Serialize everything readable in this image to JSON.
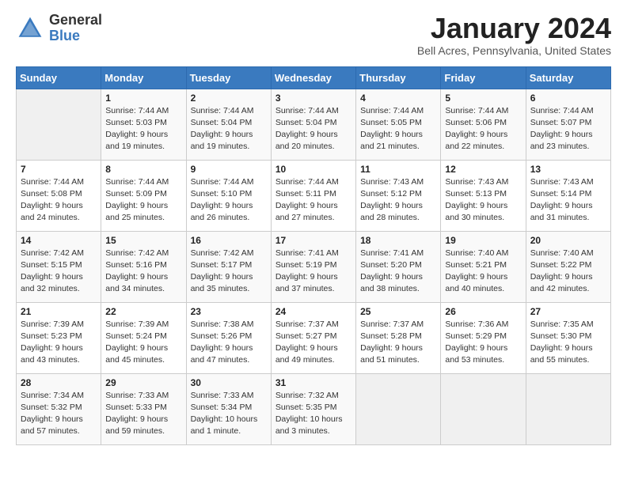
{
  "header": {
    "logo_general": "General",
    "logo_blue": "Blue",
    "month_year": "January 2024",
    "location": "Bell Acres, Pennsylvania, United States"
  },
  "weekdays": [
    "Sunday",
    "Monday",
    "Tuesday",
    "Wednesday",
    "Thursday",
    "Friday",
    "Saturday"
  ],
  "weeks": [
    [
      {
        "day": "",
        "empty": true
      },
      {
        "day": "1",
        "sunrise": "Sunrise: 7:44 AM",
        "sunset": "Sunset: 5:03 PM",
        "daylight": "Daylight: 9 hours and 19 minutes."
      },
      {
        "day": "2",
        "sunrise": "Sunrise: 7:44 AM",
        "sunset": "Sunset: 5:04 PM",
        "daylight": "Daylight: 9 hours and 19 minutes."
      },
      {
        "day": "3",
        "sunrise": "Sunrise: 7:44 AM",
        "sunset": "Sunset: 5:04 PM",
        "daylight": "Daylight: 9 hours and 20 minutes."
      },
      {
        "day": "4",
        "sunrise": "Sunrise: 7:44 AM",
        "sunset": "Sunset: 5:05 PM",
        "daylight": "Daylight: 9 hours and 21 minutes."
      },
      {
        "day": "5",
        "sunrise": "Sunrise: 7:44 AM",
        "sunset": "Sunset: 5:06 PM",
        "daylight": "Daylight: 9 hours and 22 minutes."
      },
      {
        "day": "6",
        "sunrise": "Sunrise: 7:44 AM",
        "sunset": "Sunset: 5:07 PM",
        "daylight": "Daylight: 9 hours and 23 minutes."
      }
    ],
    [
      {
        "day": "7",
        "sunrise": "Sunrise: 7:44 AM",
        "sunset": "Sunset: 5:08 PM",
        "daylight": "Daylight: 9 hours and 24 minutes."
      },
      {
        "day": "8",
        "sunrise": "Sunrise: 7:44 AM",
        "sunset": "Sunset: 5:09 PM",
        "daylight": "Daylight: 9 hours and 25 minutes."
      },
      {
        "day": "9",
        "sunrise": "Sunrise: 7:44 AM",
        "sunset": "Sunset: 5:10 PM",
        "daylight": "Daylight: 9 hours and 26 minutes."
      },
      {
        "day": "10",
        "sunrise": "Sunrise: 7:44 AM",
        "sunset": "Sunset: 5:11 PM",
        "daylight": "Daylight: 9 hours and 27 minutes."
      },
      {
        "day": "11",
        "sunrise": "Sunrise: 7:43 AM",
        "sunset": "Sunset: 5:12 PM",
        "daylight": "Daylight: 9 hours and 28 minutes."
      },
      {
        "day": "12",
        "sunrise": "Sunrise: 7:43 AM",
        "sunset": "Sunset: 5:13 PM",
        "daylight": "Daylight: 9 hours and 30 minutes."
      },
      {
        "day": "13",
        "sunrise": "Sunrise: 7:43 AM",
        "sunset": "Sunset: 5:14 PM",
        "daylight": "Daylight: 9 hours and 31 minutes."
      }
    ],
    [
      {
        "day": "14",
        "sunrise": "Sunrise: 7:42 AM",
        "sunset": "Sunset: 5:15 PM",
        "daylight": "Daylight: 9 hours and 32 minutes."
      },
      {
        "day": "15",
        "sunrise": "Sunrise: 7:42 AM",
        "sunset": "Sunset: 5:16 PM",
        "daylight": "Daylight: 9 hours and 34 minutes."
      },
      {
        "day": "16",
        "sunrise": "Sunrise: 7:42 AM",
        "sunset": "Sunset: 5:17 PM",
        "daylight": "Daylight: 9 hours and 35 minutes."
      },
      {
        "day": "17",
        "sunrise": "Sunrise: 7:41 AM",
        "sunset": "Sunset: 5:19 PM",
        "daylight": "Daylight: 9 hours and 37 minutes."
      },
      {
        "day": "18",
        "sunrise": "Sunrise: 7:41 AM",
        "sunset": "Sunset: 5:20 PM",
        "daylight": "Daylight: 9 hours and 38 minutes."
      },
      {
        "day": "19",
        "sunrise": "Sunrise: 7:40 AM",
        "sunset": "Sunset: 5:21 PM",
        "daylight": "Daylight: 9 hours and 40 minutes."
      },
      {
        "day": "20",
        "sunrise": "Sunrise: 7:40 AM",
        "sunset": "Sunset: 5:22 PM",
        "daylight": "Daylight: 9 hours and 42 minutes."
      }
    ],
    [
      {
        "day": "21",
        "sunrise": "Sunrise: 7:39 AM",
        "sunset": "Sunset: 5:23 PM",
        "daylight": "Daylight: 9 hours and 43 minutes."
      },
      {
        "day": "22",
        "sunrise": "Sunrise: 7:39 AM",
        "sunset": "Sunset: 5:24 PM",
        "daylight": "Daylight: 9 hours and 45 minutes."
      },
      {
        "day": "23",
        "sunrise": "Sunrise: 7:38 AM",
        "sunset": "Sunset: 5:26 PM",
        "daylight": "Daylight: 9 hours and 47 minutes."
      },
      {
        "day": "24",
        "sunrise": "Sunrise: 7:37 AM",
        "sunset": "Sunset: 5:27 PM",
        "daylight": "Daylight: 9 hours and 49 minutes."
      },
      {
        "day": "25",
        "sunrise": "Sunrise: 7:37 AM",
        "sunset": "Sunset: 5:28 PM",
        "daylight": "Daylight: 9 hours and 51 minutes."
      },
      {
        "day": "26",
        "sunrise": "Sunrise: 7:36 AM",
        "sunset": "Sunset: 5:29 PM",
        "daylight": "Daylight: 9 hours and 53 minutes."
      },
      {
        "day": "27",
        "sunrise": "Sunrise: 7:35 AM",
        "sunset": "Sunset: 5:30 PM",
        "daylight": "Daylight: 9 hours and 55 minutes."
      }
    ],
    [
      {
        "day": "28",
        "sunrise": "Sunrise: 7:34 AM",
        "sunset": "Sunset: 5:32 PM",
        "daylight": "Daylight: 9 hours and 57 minutes."
      },
      {
        "day": "29",
        "sunrise": "Sunrise: 7:33 AM",
        "sunset": "Sunset: 5:33 PM",
        "daylight": "Daylight: 9 hours and 59 minutes."
      },
      {
        "day": "30",
        "sunrise": "Sunrise: 7:33 AM",
        "sunset": "Sunset: 5:34 PM",
        "daylight": "Daylight: 10 hours and 1 minute."
      },
      {
        "day": "31",
        "sunrise": "Sunrise: 7:32 AM",
        "sunset": "Sunset: 5:35 PM",
        "daylight": "Daylight: 10 hours and 3 minutes."
      },
      {
        "day": "",
        "empty": true
      },
      {
        "day": "",
        "empty": true
      },
      {
        "day": "",
        "empty": true
      }
    ]
  ]
}
